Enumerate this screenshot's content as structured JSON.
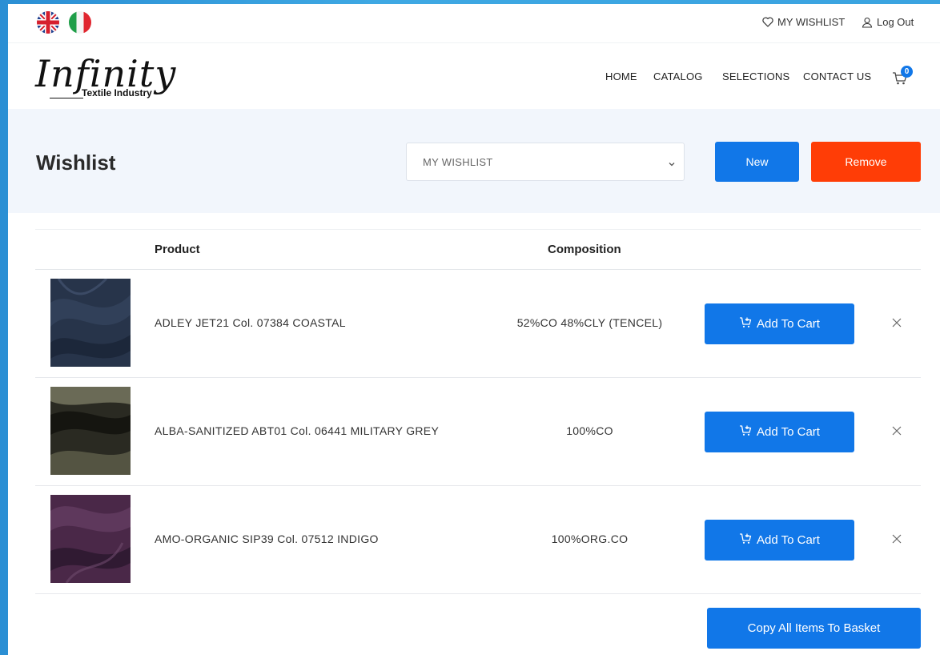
{
  "topbar": {
    "languages": [
      {
        "name": "English",
        "icon": "uk-flag-icon"
      },
      {
        "name": "Italian",
        "icon": "italy-flag-icon"
      }
    ],
    "wishlist_link": "MY WISHLIST",
    "logout_link": "Log Out"
  },
  "header": {
    "logo_text": "Infinity",
    "logo_sub": "Textile Industry",
    "nav": [
      "HOME",
      "CATALOG",
      "SELECTIONS",
      "CONTACT US"
    ],
    "cart_count": "0"
  },
  "wishlist": {
    "title": "Wishlist",
    "selected": "MY WISHLIST",
    "new_label": "New",
    "remove_label": "Remove"
  },
  "table": {
    "headers": {
      "product": "Product",
      "composition": "Composition"
    },
    "rows": [
      {
        "product": "ADLEY JET21 Col. 07384 COASTAL",
        "composition": "52%CO 48%CLY (TENCEL)",
        "add_label": "Add To Cart",
        "swatch_color": "#2e3a4e"
      },
      {
        "product": "ALBA-SANITIZED ABT01 Col. 06441 MILITARY GREY",
        "composition": "100%CO",
        "add_label": "Add To Cart",
        "swatch_color": "#3a3a2e"
      },
      {
        "product": "AMO-ORGANIC SIP39 Col. 07512 INDIGO",
        "composition": "100%ORG.CO",
        "add_label": "Add To Cart",
        "swatch_color": "#4a2a48"
      }
    ]
  },
  "copy_all_label": "Copy All Items To Basket",
  "colors": {
    "primary": "#1177e8",
    "danger": "#ff3d06",
    "band": "#f2f6fc"
  }
}
